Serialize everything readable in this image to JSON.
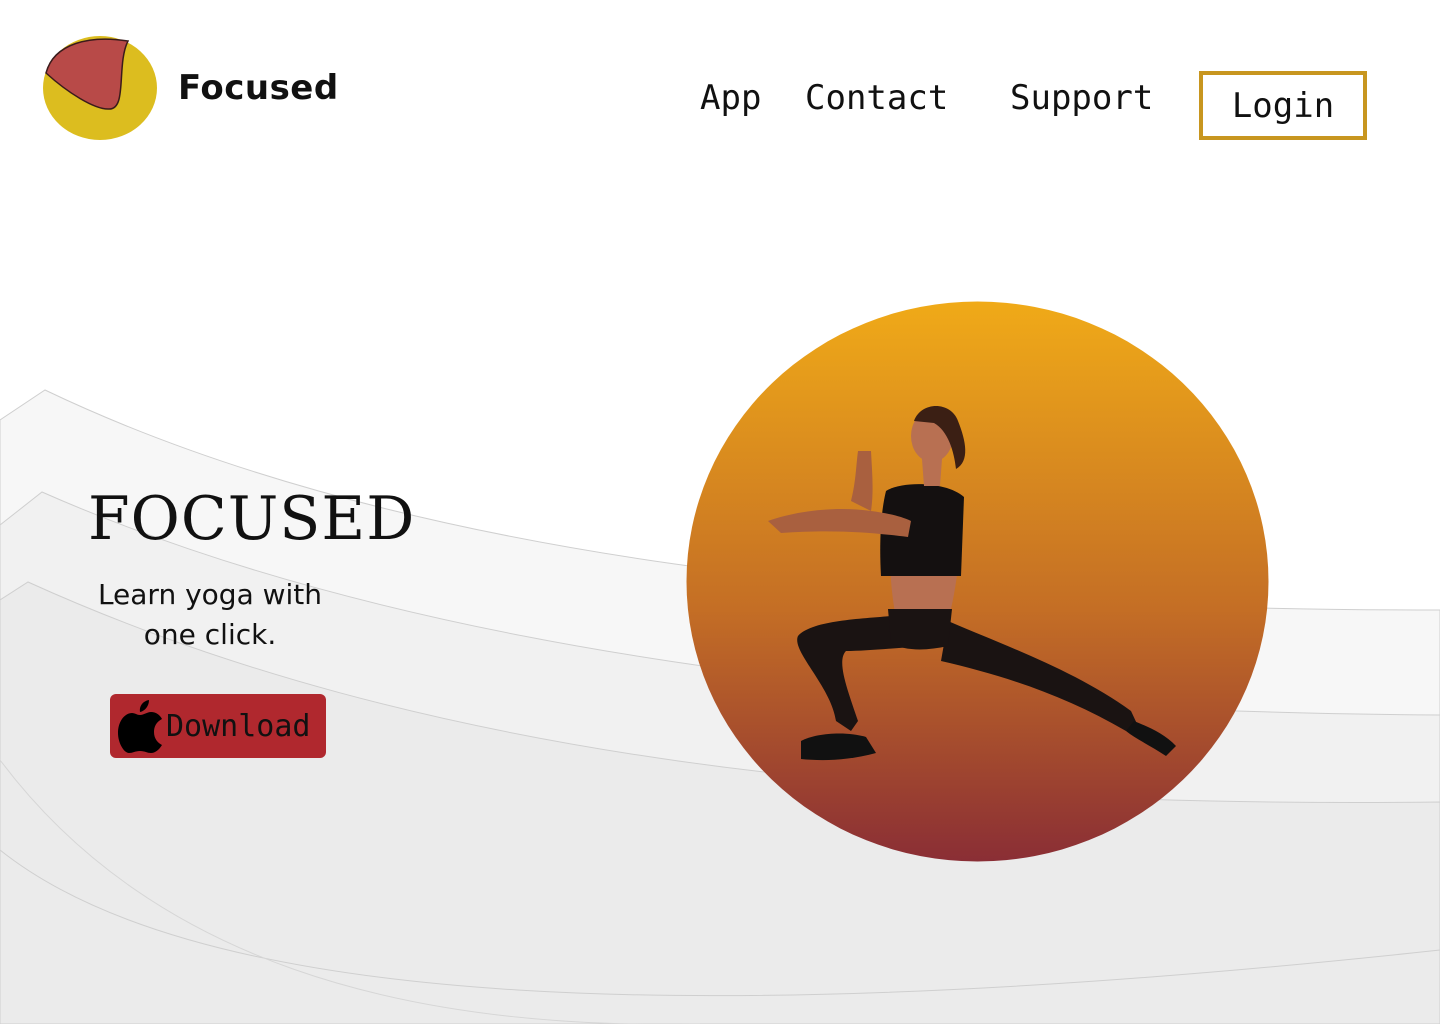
{
  "brand": {
    "name": "Focused",
    "logo_icon": "half-circle-logo-icon",
    "logo_colors": [
      "#dcbd1f",
      "#b84a48"
    ]
  },
  "nav": {
    "items": [
      {
        "label": "App"
      },
      {
        "label": "Contact"
      },
      {
        "label": "Support"
      }
    ],
    "login_label": "Login",
    "login_border_color": "#c8961f"
  },
  "hero": {
    "title": "FOCUSED",
    "tagline": "Learn yoga with one click.",
    "download": {
      "label": "Download",
      "icon": "apple-icon",
      "color": "#b0282e"
    },
    "image": {
      "subject": "woman-stretching-lunge",
      "gradient_top": "#f0aa18",
      "gradient_bottom": "#8a2e35"
    }
  }
}
